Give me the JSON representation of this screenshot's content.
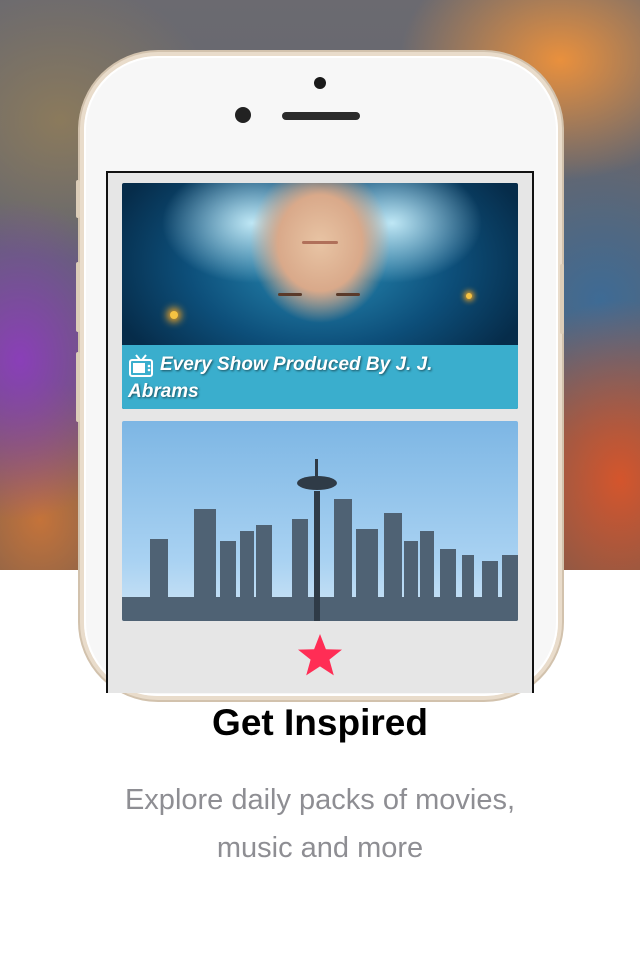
{
  "card_1": {
    "caption": "Every Show Produced By J. J. Abrams",
    "icon": "tv-icon"
  },
  "card_2": {
    "icon": "skyline-image"
  },
  "feature": {
    "icon": "star-icon",
    "icon_color": "#ff2d55",
    "title": "Get Inspired",
    "subtitle": "Explore daily packs of movies, music and more"
  },
  "colors": {
    "caption_bar": "#3aaecd",
    "subtitle_text": "#8e8e93"
  }
}
